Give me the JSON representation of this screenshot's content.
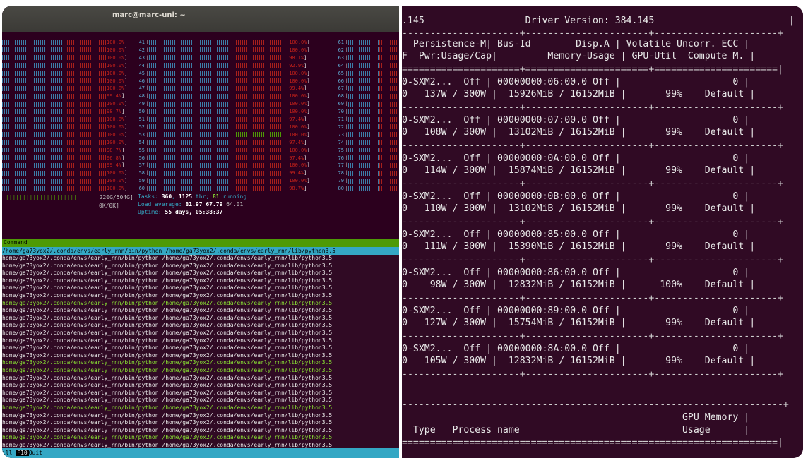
{
  "window": {
    "title": "marc@marc-uni: ~"
  },
  "htop": {
    "cpus_col1": [
      {
        "pct": "100.0%",
        "c": "r"
      },
      {
        "pct": "100.0%",
        "c": "r"
      },
      {
        "pct": "100.0%",
        "c": "r"
      },
      {
        "pct": "100.0%",
        "c": "r"
      },
      {
        "pct": "100.0%",
        "c": "r"
      },
      {
        "pct": "100.0%",
        "c": "r"
      },
      {
        "pct": "100.0%",
        "c": "r"
      },
      {
        "pct": "99.4%",
        "c": "r"
      },
      {
        "pct": "100.0%",
        "c": "r"
      },
      {
        "pct": "98.7%",
        "c": "r"
      },
      {
        "pct": "100.0%",
        "c": "r"
      },
      {
        "pct": "100.0%",
        "c": "r"
      },
      {
        "pct": "100.0%",
        "c": "r"
      },
      {
        "pct": "100.0%",
        "c": "r"
      },
      {
        "pct": "98.7%",
        "c": "r"
      },
      {
        "pct": "96.8%",
        "c": "r"
      },
      {
        "pct": "99.4%",
        "c": "r"
      },
      {
        "pct": "100.0%",
        "c": "r"
      },
      {
        "pct": "100.0%",
        "c": "r"
      },
      {
        "pct": "100.0%",
        "c": "r"
      }
    ],
    "cpus_col2": [
      {
        "n": "41",
        "pct": "100.0%",
        "c": "r"
      },
      {
        "n": "42",
        "pct": "100.0%",
        "c": "r"
      },
      {
        "n": "43",
        "pct": "98.1%",
        "c": "r"
      },
      {
        "n": "44",
        "pct": "92.9%",
        "c": "r"
      },
      {
        "n": "45",
        "pct": "100.0%",
        "c": "r"
      },
      {
        "n": "46",
        "pct": "100.0%",
        "c": "r"
      },
      {
        "n": "47",
        "pct": "99.4%",
        "c": "r"
      },
      {
        "n": "48",
        "pct": "100.0%",
        "c": "r"
      },
      {
        "n": "49",
        "pct": "100.0%",
        "c": "r"
      },
      {
        "n": "50",
        "pct": "100.0%",
        "c": "r"
      },
      {
        "n": "51",
        "pct": "97.4%",
        "c": "r"
      },
      {
        "n": "52",
        "pct": "100.0%",
        "c": "r"
      },
      {
        "n": "53",
        "pct": "100.0%",
        "c": "g"
      },
      {
        "n": "54",
        "pct": "97.4%",
        "c": "r"
      },
      {
        "n": "55",
        "pct": "100.0%",
        "c": "r"
      },
      {
        "n": "56",
        "pct": "97.4%",
        "c": "r"
      },
      {
        "n": "57",
        "pct": "100.0%",
        "c": "r"
      },
      {
        "n": "58",
        "pct": "99.4%",
        "c": "r"
      },
      {
        "n": "59",
        "pct": "100.0%",
        "c": "r"
      },
      {
        "n": "60",
        "pct": "98.7%",
        "c": "r"
      }
    ],
    "cpus_col3": [
      "61",
      "62",
      "63",
      "64",
      "65",
      "66",
      "67",
      "68",
      "69",
      "70",
      "71",
      "72",
      "73",
      "74",
      "75",
      "76",
      "77",
      "78",
      "79",
      "80"
    ],
    "mem": "220G/504G",
    "swp": "0K/0K",
    "tasks_label": "Tasks: ",
    "tasks": "360",
    "thr": "1125",
    "thr_label": " thr; ",
    "running": "81",
    "running_label": " running",
    "load_label": "Load average: ",
    "load1": "81.97",
    "load5": "67.79",
    "load15": "64.01",
    "uptime_label": "Uptime: ",
    "uptime": "55 days, 05:38:37",
    "command_header": "Command",
    "command": "/home/ga73yox2/.conda/envs/early_rnn/bin/python /home/ga73yox2/.conda/envs/early_rnn/lib/python3.5",
    "footer_kill": "ill ",
    "footer_f10": "F10",
    "footer_quit": "Quit"
  },
  "smi": {
    "driver_line": ".145                  Driver Version: 384.145                        |",
    "hdr1": "  Persistence-M| Bus-Id        Disp.A | Volatile Uncorr. ECC |",
    "hdr2": "F  Pwr:Usage/Cap|         Memory-Usage | GPU-Util  Compute M. |",
    "gpus": [
      {
        "name": "0-SXM2...  Off",
        "bus": "00000000:06:00.0 Off",
        "pwr": "137W / 300W",
        "mem": "15926MiB / 16152MiB",
        "util": "99%",
        "ecc": "0",
        "mode": "Default"
      },
      {
        "name": "0-SXM2...  Off",
        "bus": "00000000:07:00.0 Off",
        "pwr": "108W / 300W",
        "mem": "13102MiB / 16152MiB",
        "util": "99%",
        "ecc": "0",
        "mode": "Default"
      },
      {
        "name": "0-SXM2...  Off",
        "bus": "00000000:0A:00.0 Off",
        "pwr": "114W / 300W",
        "mem": "15874MiB / 16152MiB",
        "util": "99%",
        "ecc": "0",
        "mode": "Default"
      },
      {
        "name": "0-SXM2...  Off",
        "bus": "00000000:0B:00.0 Off",
        "pwr": "110W / 300W",
        "mem": "13102MiB / 16152MiB",
        "util": "99%",
        "ecc": "0",
        "mode": "Default"
      },
      {
        "name": "0-SXM2...  Off",
        "bus": "00000000:85:00.0 Off",
        "pwr": "111W / 300W",
        "mem": "15390MiB / 16152MiB",
        "util": "99%",
        "ecc": "0",
        "mode": "Default"
      },
      {
        "name": "0-SXM2...  Off",
        "bus": "00000000:86:00.0 Off",
        "pwr": " 98W / 300W",
        "mem": "12832MiB / 16152MiB",
        "util": "100%",
        "ecc": "0",
        "mode": "Default"
      },
      {
        "name": "0-SXM2...  Off",
        "bus": "00000000:89:00.0 Off",
        "pwr": "127W / 300W",
        "mem": "15754MiB / 16152MiB",
        "util": "99%",
        "ecc": "0",
        "mode": "Default"
      },
      {
        "name": "0-SXM2...  Off",
        "bus": "00000000:8A:00.0 Off",
        "pwr": "105W / 300W",
        "mem": "12832MiB / 16152MiB",
        "util": "99%",
        "ecc": "0",
        "mode": "Default"
      }
    ],
    "proc_hdr1": "                                                  GPU Memory |",
    "proc_hdr2": "  Type   Process name                             Usage      |"
  }
}
